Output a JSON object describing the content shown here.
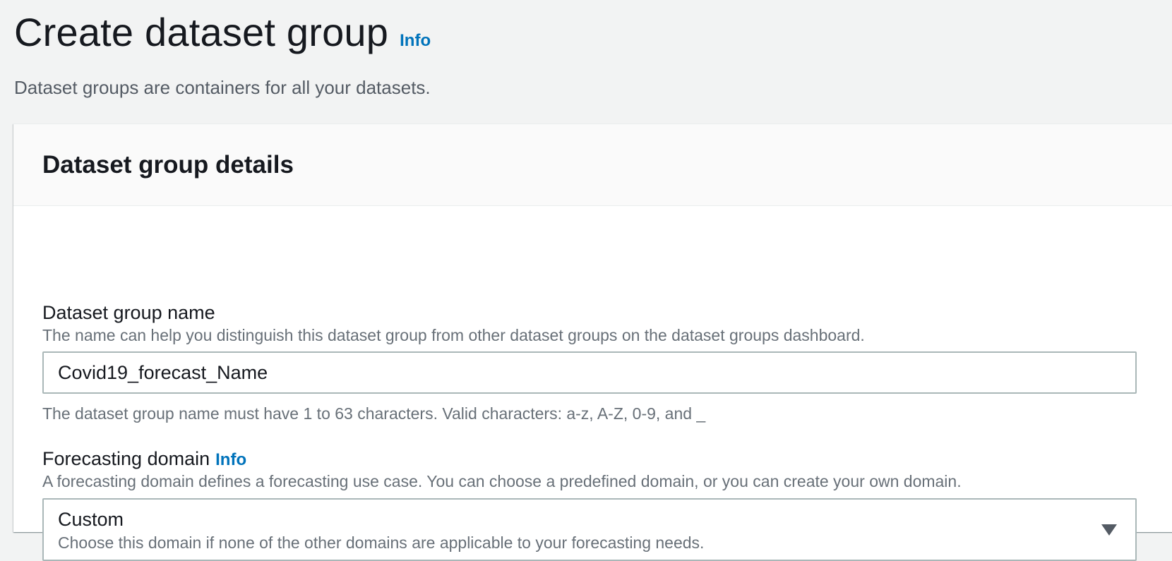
{
  "page": {
    "title": "Create dataset group",
    "title_info": "Info",
    "description": "Dataset groups are containers for all your datasets."
  },
  "panel": {
    "title": "Dataset group details"
  },
  "dataset_group_name": {
    "label": "Dataset group name",
    "description": "The name can help you distinguish this dataset group from other dataset groups on the dataset groups dashboard.",
    "value": "Covid19_forecast_Name",
    "constraint": "The dataset group name must have 1 to 63 characters. Valid characters: a-z, A-Z, 0-9, and _"
  },
  "forecasting_domain": {
    "label": "Forecasting domain",
    "label_info": "Info",
    "description": "A forecasting domain defines a forecasting use case. You can choose a predefined domain, or you can create your own domain.",
    "selected": "Custom",
    "selected_description": "Choose this domain if none of the other domains are applicable to your forecasting needs.",
    "icon": "caret-down-icon"
  },
  "colors": {
    "link": "#0073bb",
    "text": "#16191f",
    "muted": "#687078",
    "background": "#f2f3f3"
  }
}
